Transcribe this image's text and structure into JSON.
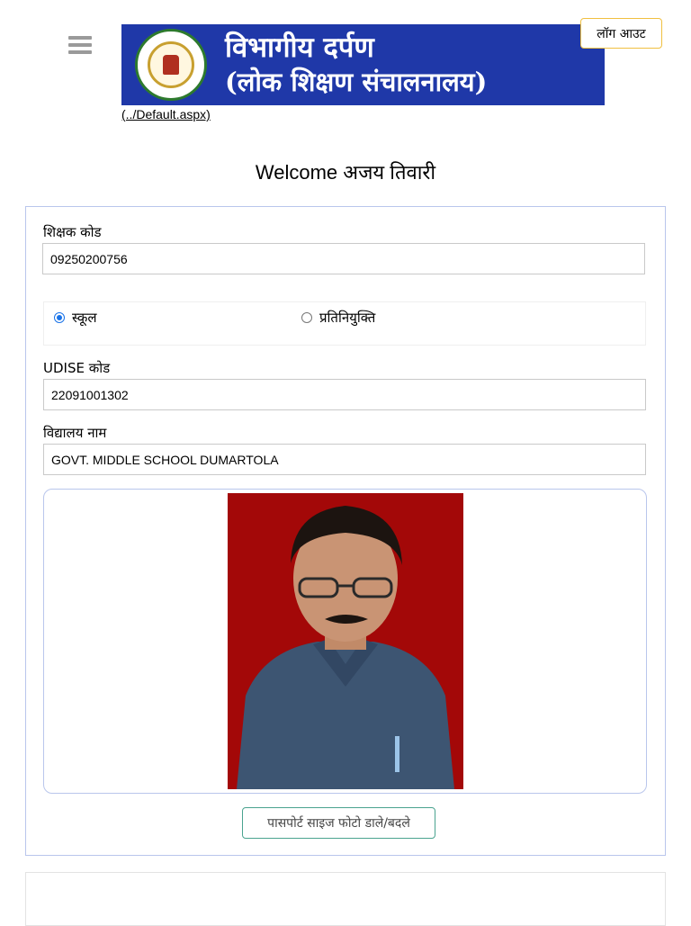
{
  "header": {
    "menu_icon": "hamburger-menu-icon",
    "banner_line1": "विभागीय दर्पण",
    "banner_line2": "(लोक शिक्षण संचालनालय)",
    "emblem_icon": "state-emblem-logo",
    "logout_label": "लॉग आउट",
    "default_link": "(../Default.aspx)"
  },
  "welcome_text": "Welcome अजय तिवारी",
  "form": {
    "teacher_code_label": "शिक्षक कोड",
    "teacher_code_value": "09250200756",
    "radio_options": [
      {
        "label": "स्कूल",
        "checked": true
      },
      {
        "label": "प्रतिनियुक्ति",
        "checked": false
      }
    ],
    "udise_label": "UDISE कोड",
    "udise_value": "22091001302",
    "school_name_label": "विद्यालय नाम",
    "school_name_value": "GOVT. MIDDLE SCHOOL DUMARTOLA",
    "photo_icon": "passport-photo-image",
    "upload_button_label": "पासपोर्ट साइज फोटो डाले/बदले"
  },
  "colors": {
    "banner_bg": "#1f38a8",
    "photo_bg": "#a30808",
    "card_border": "#b9c6ec",
    "logout_border": "#f0c040",
    "upload_border": "#4aa38f"
  }
}
